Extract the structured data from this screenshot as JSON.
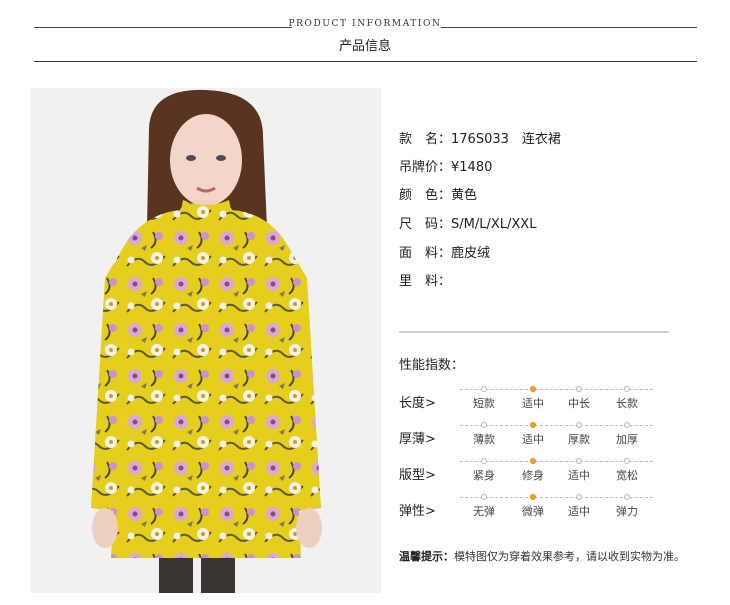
{
  "header": {
    "title_en": "PRODUCT INFORMATION",
    "title_cn": "产品信息"
  },
  "product": {
    "specs": [
      {
        "key": "款　名：",
        "value": "176S033　连衣裙"
      },
      {
        "key": "吊牌价：",
        "value": "¥1480"
      },
      {
        "key": "颜　色：",
        "value": "黄色"
      },
      {
        "key": "尺　码：",
        "value": "S/M/L/XL/XXL"
      },
      {
        "key": "面　料：",
        "value": "鹿皮绒"
      },
      {
        "key": "里　料：",
        "value": ""
      }
    ]
  },
  "performance": {
    "title": "性能指数：",
    "rows": [
      {
        "label": "长度>",
        "options": [
          "短款",
          "适中",
          "中长",
          "长款"
        ],
        "selected_index": 1
      },
      {
        "label": "厚薄>",
        "options": [
          "薄款",
          "适中",
          "厚款",
          "加厚"
        ],
        "selected_index": 1
      },
      {
        "label": "版型>",
        "options": [
          "紧身",
          "修身",
          "适中",
          "宽松"
        ],
        "selected_index": 1
      },
      {
        "label": "弹性>",
        "options": [
          "无弹",
          "微弹",
          "适中",
          "弹力"
        ],
        "selected_index": 1
      }
    ]
  },
  "tip": {
    "label": "温馨提示：",
    "text": "模特图仅为穿着效果参考，请以收到实物为准。"
  },
  "colors": {
    "selected_dot": "#f0a030",
    "dress_yellow": "#e8d21a"
  }
}
